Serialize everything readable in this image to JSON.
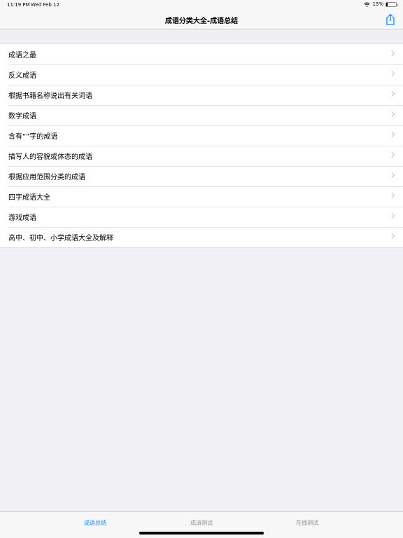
{
  "status_bar": {
    "time": "11:19 PM",
    "date": "Wed Feb 12",
    "battery_text": "15%",
    "battery_level": 0.15
  },
  "nav": {
    "title": "成语分类大全-成语总结",
    "share_icon": "share-icon"
  },
  "list": {
    "items": [
      {
        "label": "成语之最"
      },
      {
        "label": "反义成语"
      },
      {
        "label": "根据书籍名称说出有关词语"
      },
      {
        "label": "数字成语"
      },
      {
        "label": "含有“”字的成语"
      },
      {
        "label": "描写人的容貌或体态的成语"
      },
      {
        "label": "根据应用范围分类的成语"
      },
      {
        "label": "四字成语大全"
      },
      {
        "label": "游戏成语"
      },
      {
        "label": "高中、初中、小学成语大全及解释"
      }
    ]
  },
  "tabs": [
    {
      "label": "成语总结",
      "active": true
    },
    {
      "label": "成语测试",
      "active": false
    },
    {
      "label": "在线测试",
      "active": false
    }
  ],
  "colors": {
    "accent": "#1a82fb",
    "background": "#efeff4",
    "inactive_tab": "#8e8e93"
  }
}
